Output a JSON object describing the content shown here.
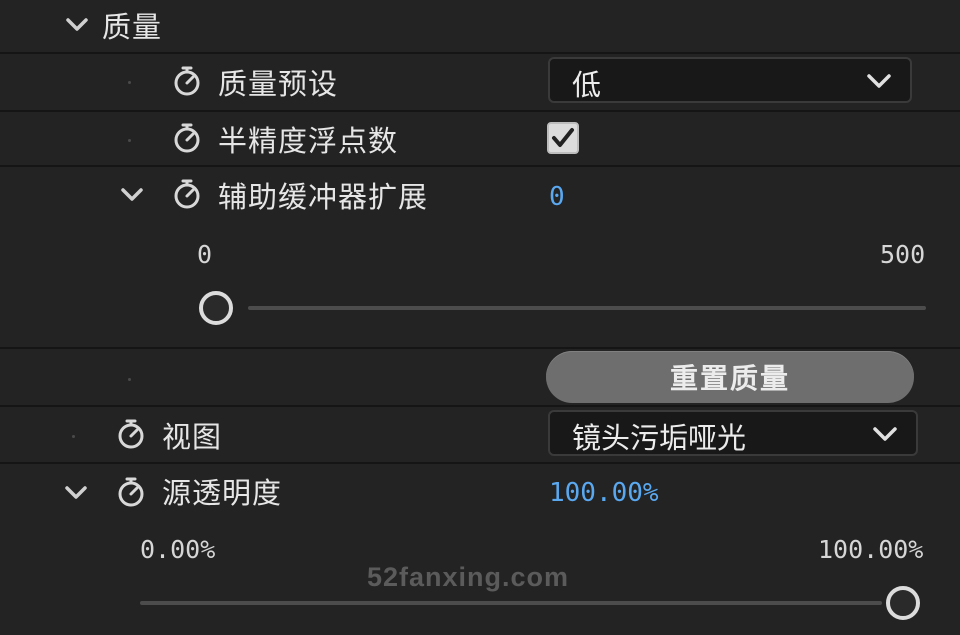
{
  "section": {
    "title": "质量",
    "expanded": true
  },
  "quality_preset": {
    "label": "质量预设",
    "value": "低",
    "icon": "stopwatch-icon"
  },
  "half_precision": {
    "label": "半精度浮点数",
    "checked": true,
    "icon": "stopwatch-icon"
  },
  "aux_buffer": {
    "label": "辅助缓冲器扩展",
    "value": "0",
    "min_label": "0",
    "max_label": "500",
    "slider_fraction": 0.0,
    "expanded": true
  },
  "reset_button": {
    "label": "重置质量"
  },
  "view": {
    "label": "视图",
    "value": "镜头污垢哑光"
  },
  "source_opacity": {
    "label": "源透明度",
    "value": "100.00%",
    "min_label": "0.00%",
    "max_label": "100.00%",
    "slider_fraction": 1.0,
    "expanded": true
  },
  "watermark": "52fanxing.com",
  "colors": {
    "background": "#232323",
    "value_blue": "#5aa8f0",
    "button_gray": "#6e6e6e",
    "separator": "#151515"
  }
}
